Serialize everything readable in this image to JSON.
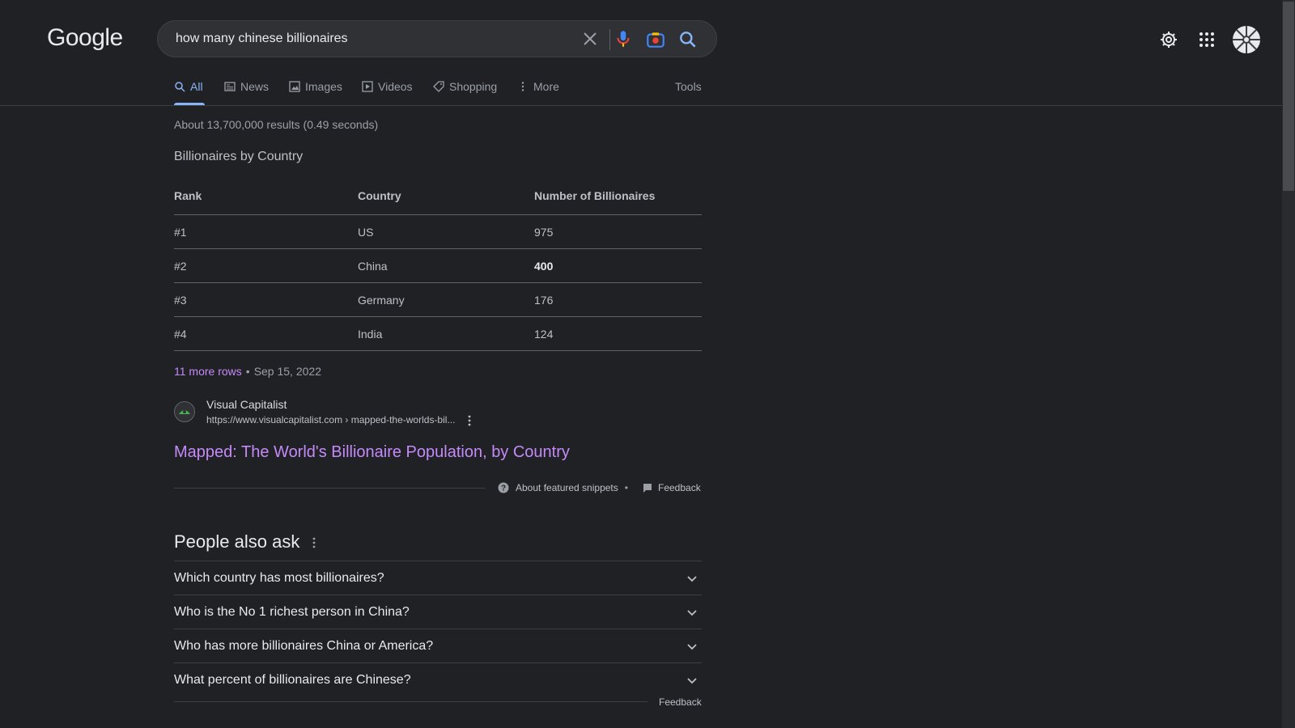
{
  "header": {
    "logo": "Google",
    "search_query": "how many chinese billionaires"
  },
  "tabs": {
    "items": [
      "All",
      "News",
      "Images",
      "Videos",
      "Shopping",
      "More"
    ],
    "tools": "Tools",
    "active": "All"
  },
  "results_stats": "About 13,700,000 results (0.49 seconds)",
  "featured_snippet": {
    "title": "Billionaires by Country",
    "columns": [
      "Rank",
      "Country",
      "Number of Billionaires"
    ],
    "rows": [
      [
        "#1",
        "US",
        "975"
      ],
      [
        "#2",
        "China",
        "400"
      ],
      [
        "#3",
        "Germany",
        "176"
      ],
      [
        "#4",
        "India",
        "124"
      ]
    ],
    "more_rows": "11 more rows",
    "date": "Sep 15, 2022",
    "source_name": "Visual Capitalist",
    "source_url": "https://www.visualcapitalist.com › mapped-the-worlds-bil...",
    "result_title": "Mapped: The World's Billionaire Population, by Country",
    "about_label": "About featured snippets",
    "feedback_label": "Feedback"
  },
  "people_also_ask": {
    "title": "People also ask",
    "questions": [
      "Which country has most billionaires?",
      "Who is the No 1 richest person in China?",
      "Who has more billionaires China or America?",
      "What percent of billionaires are Chinese?"
    ],
    "feedback_label": "Feedback"
  },
  "colors": {
    "background": "#202124",
    "link_visited": "#c58af9",
    "accent_blue": "#8ab4f8",
    "text": "#bdc1c6"
  }
}
